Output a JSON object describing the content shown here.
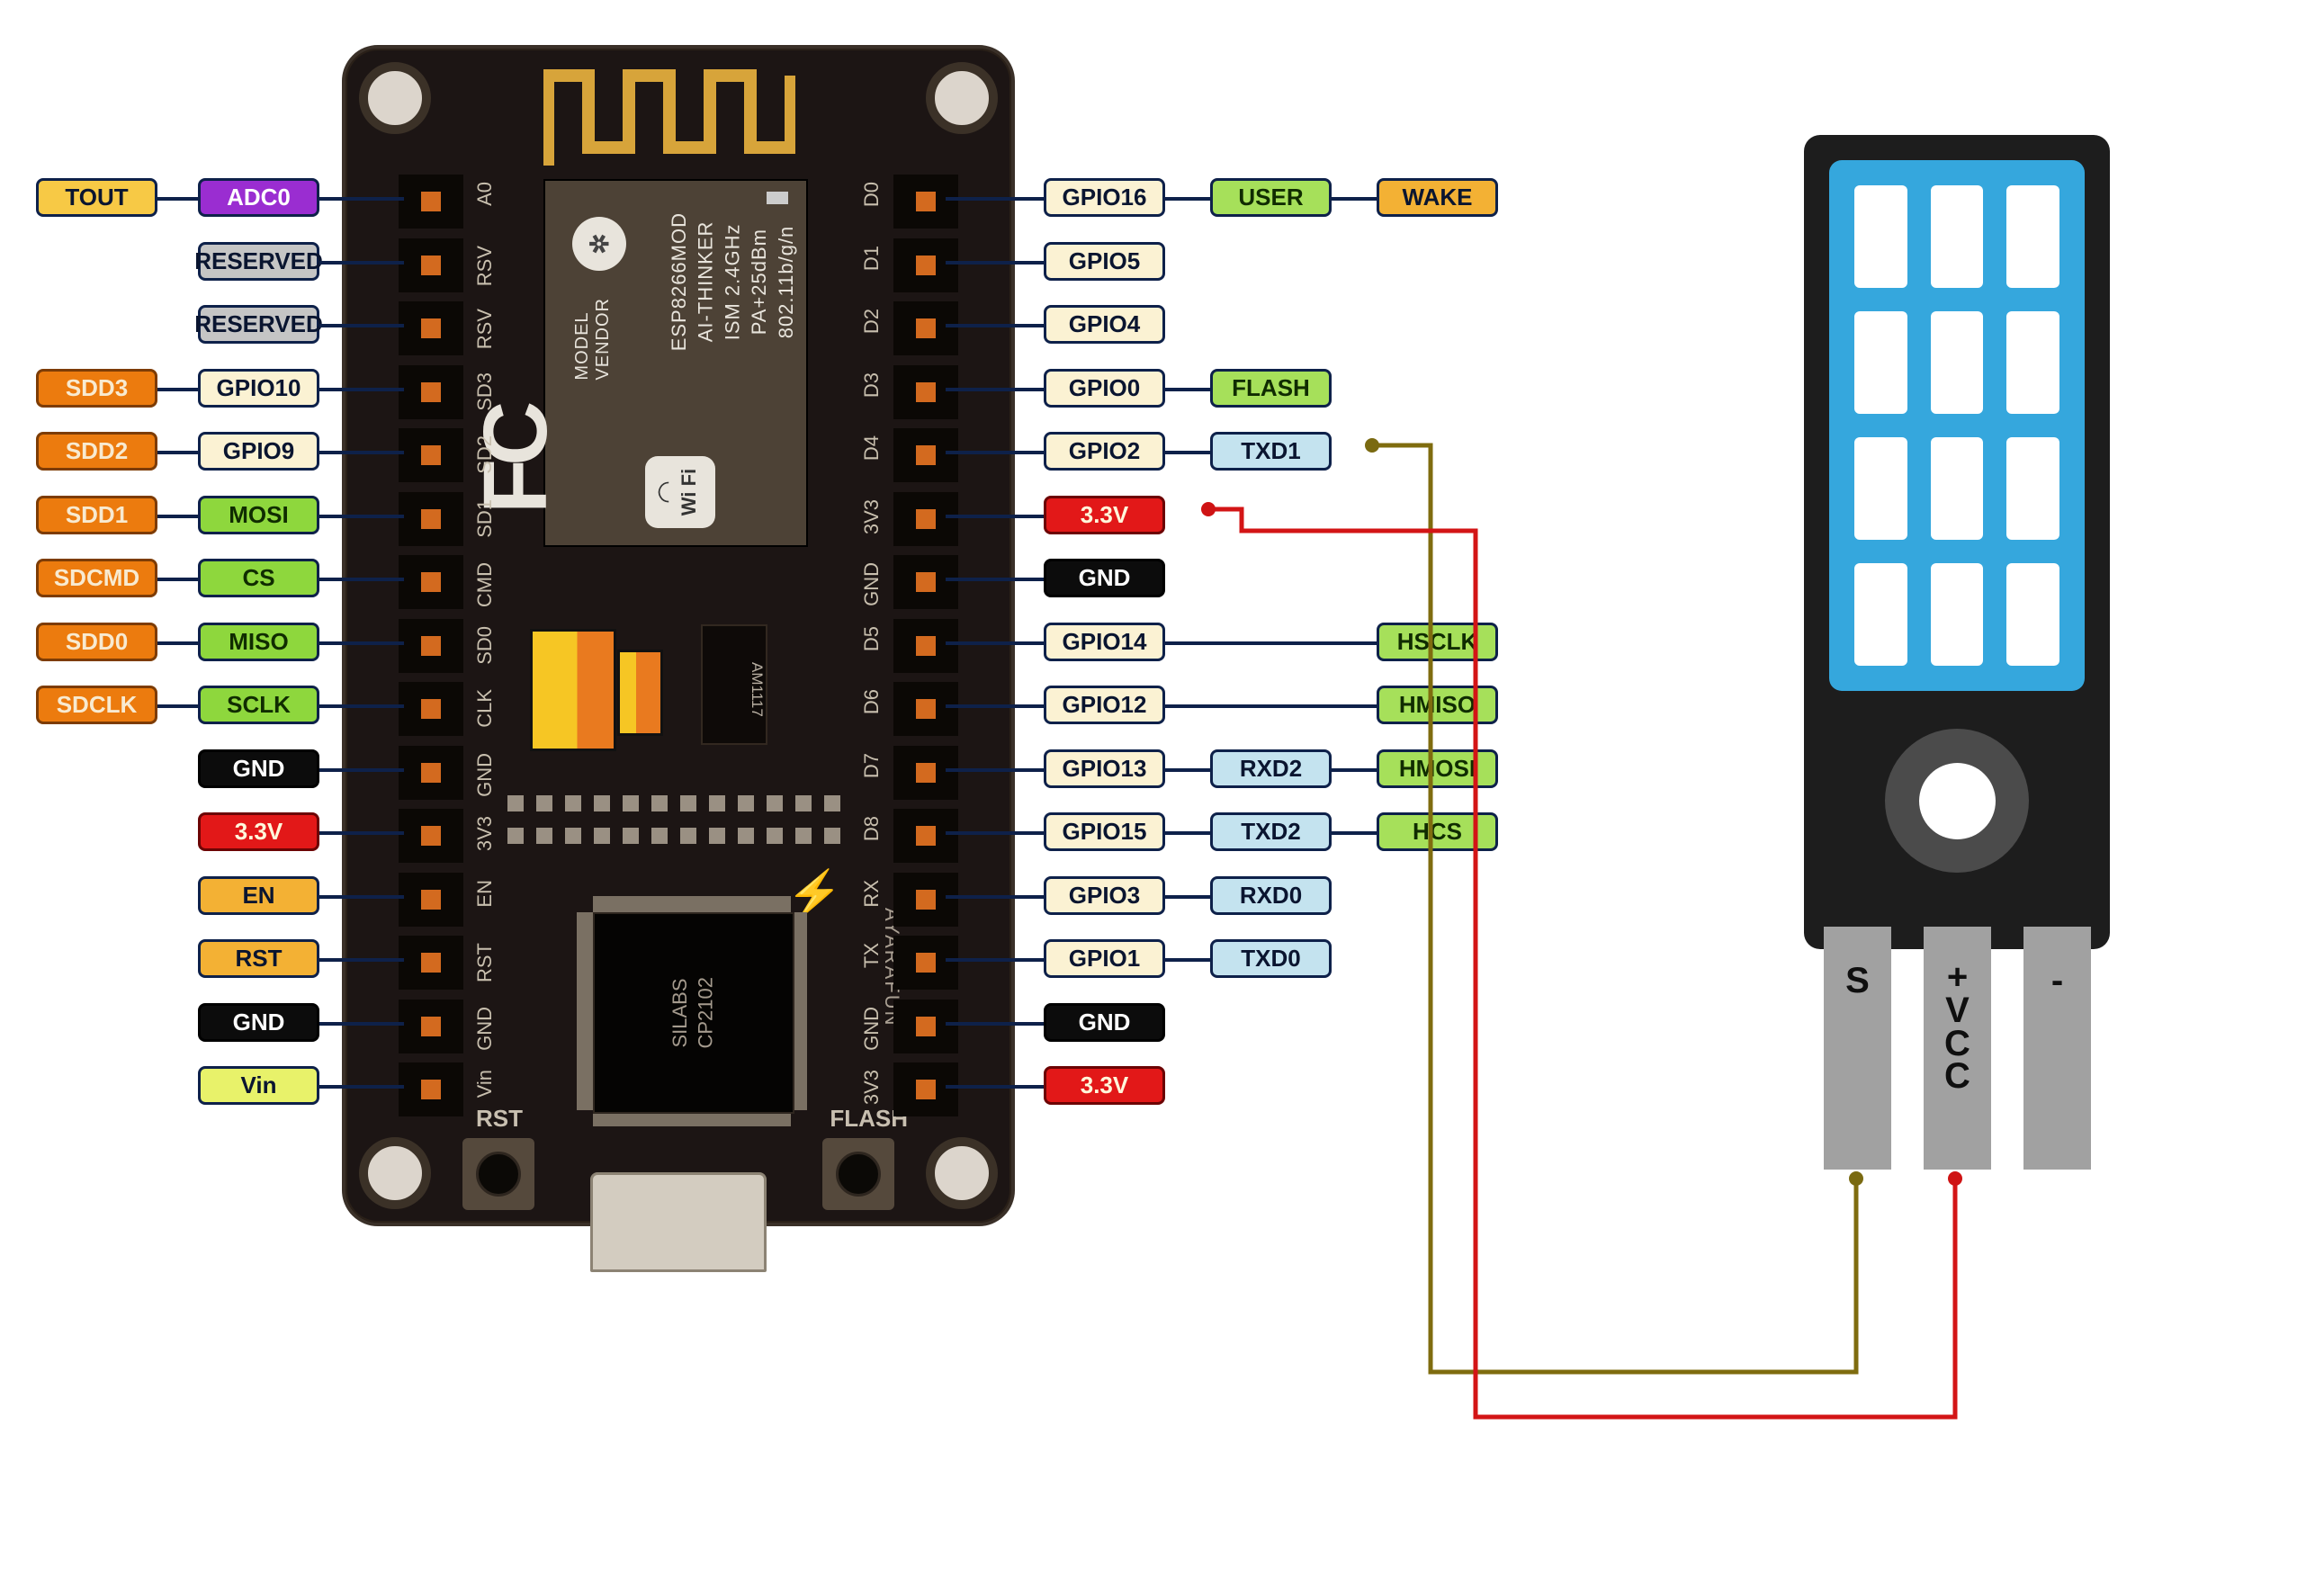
{
  "board": {
    "module_lines": [
      "ESP8266MOD",
      "AI-THINKER",
      "ISM 2.4GHz",
      "PA+25dBm",
      "802.11b/g/n"
    ],
    "vendor_word": "VENDOR",
    "vendor_label": "MODEL",
    "wifi_text": "Fi",
    "wifi_text2": "Wi",
    "fc": "FC",
    "am_label": "AM1117",
    "chip_line1": "SILABS",
    "chip_line2": "CP2102",
    "brand": "AYARAFUN",
    "btn_rst": "RST",
    "btn_flash": "FLASH"
  },
  "silk_left": [
    "A0",
    "RSV",
    "RSV",
    "SD3",
    "SD2",
    "SD1",
    "CMD",
    "SD0",
    "CLK",
    "GND",
    "3V3",
    "EN",
    "RST",
    "GND",
    "Vin"
  ],
  "silk_right": [
    "D0",
    "D1",
    "D2",
    "D3",
    "D4",
    "3V3",
    "GND",
    "D5",
    "D6",
    "D7",
    "D8",
    "RX",
    "TX",
    "GND",
    "3V3"
  ],
  "left_labels": [
    {
      "col": 1,
      "row": 0,
      "text": "TOUT",
      "cls": "c-yellow"
    },
    {
      "col": 2,
      "row": 0,
      "text": "ADC0",
      "cls": "c-purple"
    },
    {
      "col": 2,
      "row": 1,
      "text": "RESERVED",
      "cls": "c-grey"
    },
    {
      "col": 2,
      "row": 2,
      "text": "RESERVED",
      "cls": "c-grey"
    },
    {
      "col": 1,
      "row": 3,
      "text": "SDD3",
      "cls": "c-orange"
    },
    {
      "col": 2,
      "row": 3,
      "text": "GPIO10",
      "cls": "c-cream"
    },
    {
      "col": 1,
      "row": 4,
      "text": "SDD2",
      "cls": "c-orange"
    },
    {
      "col": 2,
      "row": 4,
      "text": "GPIO9",
      "cls": "c-cream"
    },
    {
      "col": 1,
      "row": 5,
      "text": "SDD1",
      "cls": "c-orange"
    },
    {
      "col": 2,
      "row": 5,
      "text": "MOSI",
      "cls": "c-green"
    },
    {
      "col": 1,
      "row": 6,
      "text": "SDCMD",
      "cls": "c-orange"
    },
    {
      "col": 2,
      "row": 6,
      "text": "CS",
      "cls": "c-green"
    },
    {
      "col": 1,
      "row": 7,
      "text": "SDD0",
      "cls": "c-orange"
    },
    {
      "col": 2,
      "row": 7,
      "text": "MISO",
      "cls": "c-green"
    },
    {
      "col": 1,
      "row": 8,
      "text": "SDCLK",
      "cls": "c-orange"
    },
    {
      "col": 2,
      "row": 8,
      "text": "SCLK",
      "cls": "c-green"
    },
    {
      "col": 2,
      "row": 9,
      "text": "GND",
      "cls": "c-black"
    },
    {
      "col": 2,
      "row": 10,
      "text": "3.3V",
      "cls": "c-red"
    },
    {
      "col": 2,
      "row": 11,
      "text": "EN",
      "cls": "c-gold"
    },
    {
      "col": 2,
      "row": 12,
      "text": "RST",
      "cls": "c-gold"
    },
    {
      "col": 2,
      "row": 13,
      "text": "GND",
      "cls": "c-black"
    },
    {
      "col": 2,
      "row": 14,
      "text": "Vin",
      "cls": "c-ygreen"
    }
  ],
  "right_labels": [
    {
      "col": 1,
      "row": 0,
      "text": "GPIO16",
      "cls": "c-cream"
    },
    {
      "col": 2,
      "row": 0,
      "text": "USER",
      "cls": "c-lgreen"
    },
    {
      "col": 3,
      "row": 0,
      "text": "WAKE",
      "cls": "c-gold"
    },
    {
      "col": 1,
      "row": 1,
      "text": "GPIO5",
      "cls": "c-cream"
    },
    {
      "col": 1,
      "row": 2,
      "text": "GPIO4",
      "cls": "c-cream"
    },
    {
      "col": 1,
      "row": 3,
      "text": "GPIO0",
      "cls": "c-cream"
    },
    {
      "col": 2,
      "row": 3,
      "text": "FLASH",
      "cls": "c-lgreen"
    },
    {
      "col": 1,
      "row": 4,
      "text": "GPIO2",
      "cls": "c-cream"
    },
    {
      "col": 2,
      "row": 4,
      "text": "TXD1",
      "cls": "c-cyan"
    },
    {
      "col": 1,
      "row": 5,
      "text": "3.3V",
      "cls": "c-red"
    },
    {
      "col": 1,
      "row": 6,
      "text": "GND",
      "cls": "c-black"
    },
    {
      "col": 1,
      "row": 7,
      "text": "GPIO14",
      "cls": "c-cream"
    },
    {
      "col": 3,
      "row": 7,
      "text": "HSCLK",
      "cls": "c-lgreen"
    },
    {
      "col": 1,
      "row": 8,
      "text": "GPIO12",
      "cls": "c-cream"
    },
    {
      "col": 3,
      "row": 8,
      "text": "HMISO",
      "cls": "c-lgreen"
    },
    {
      "col": 1,
      "row": 9,
      "text": "GPIO13",
      "cls": "c-cream"
    },
    {
      "col": 2,
      "row": 9,
      "text": "RXD2",
      "cls": "c-cyan"
    },
    {
      "col": 3,
      "row": 9,
      "text": "HMOSI",
      "cls": "c-lgreen"
    },
    {
      "col": 1,
      "row": 10,
      "text": "GPIO15",
      "cls": "c-cream"
    },
    {
      "col": 2,
      "row": 10,
      "text": "TXD2",
      "cls": "c-cyan"
    },
    {
      "col": 3,
      "row": 10,
      "text": "HCS",
      "cls": "c-lgreen"
    },
    {
      "col": 1,
      "row": 11,
      "text": "GPIO3",
      "cls": "c-cream"
    },
    {
      "col": 2,
      "row": 11,
      "text": "RXD0",
      "cls": "c-cyan"
    },
    {
      "col": 1,
      "row": 12,
      "text": "GPIO1",
      "cls": "c-cream"
    },
    {
      "col": 2,
      "row": 12,
      "text": "TXD0",
      "cls": "c-cyan"
    },
    {
      "col": 1,
      "row": 13,
      "text": "GND",
      "cls": "c-black"
    },
    {
      "col": 1,
      "row": 14,
      "text": "3.3V",
      "cls": "c-red"
    }
  ],
  "dht": {
    "pin_s": "S",
    "pin_vcc": [
      "+",
      "V",
      "C",
      "C"
    ],
    "pin_minus": "-"
  },
  "wiring": {
    "signal": {
      "from": "NodeMCU GPIO2 / TXD1",
      "to": "DHT pin S",
      "color": "#7f6c0f"
    },
    "power": {
      "from": "NodeMCU 3.3V (row 5 right)",
      "to": "DHT pin +VCC",
      "color": "#d31516"
    }
  },
  "colors": {
    "board": "#1c1514",
    "pcb_accent": "#d36a1f",
    "sensor_body": "#1d1d1d",
    "sensor_grill": "#35a7dd",
    "wire_signal": "#7f6c0f",
    "wire_power": "#d31516"
  }
}
